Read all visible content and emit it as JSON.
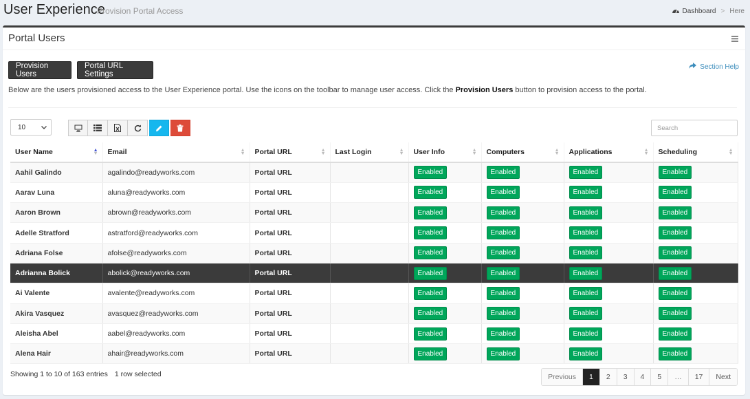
{
  "header": {
    "title": "User Experience",
    "subtitle": "Provision Portal Access",
    "breadcrumb": {
      "home": "Dashboard",
      "separator": ">",
      "current": "Here"
    }
  },
  "box": {
    "title": "Portal Users"
  },
  "buttons": {
    "provision_users": "Provision Users",
    "portal_url_settings": "Portal URL Settings",
    "section_help": "Section Help"
  },
  "description": {
    "part1": "Below are the users provisioned access to the User Experience portal. Use the icons on the toolbar to manage user access. Click the ",
    "bold": "Provision Users",
    "part2": " button to provision access to the portal."
  },
  "length_select": {
    "value": "10"
  },
  "search": {
    "placeholder": "Search"
  },
  "columns": [
    "User Name",
    "Email",
    "Portal URL",
    "Last Login",
    "User Info",
    "Computers",
    "Applications",
    "Scheduling"
  ],
  "rows": [
    {
      "name": "Aahil Galindo",
      "email": "agalindo@readyworks.com",
      "portal_url": "Portal URL",
      "last_login": "",
      "user_info": "Enabled",
      "computers": "Enabled",
      "applications": "Enabled",
      "scheduling": "Enabled"
    },
    {
      "name": "Aarav Luna",
      "email": "aluna@readyworks.com",
      "portal_url": "Portal URL",
      "last_login": "",
      "user_info": "Enabled",
      "computers": "Enabled",
      "applications": "Enabled",
      "scheduling": "Enabled"
    },
    {
      "name": "Aaron Brown",
      "email": "abrown@readyworks.com",
      "portal_url": "Portal URL",
      "last_login": "",
      "user_info": "Enabled",
      "computers": "Enabled",
      "applications": "Enabled",
      "scheduling": "Enabled"
    },
    {
      "name": "Adelle Stratford",
      "email": "astratford@readyworks.com",
      "portal_url": "Portal URL",
      "last_login": "",
      "user_info": "Enabled",
      "computers": "Enabled",
      "applications": "Enabled",
      "scheduling": "Enabled"
    },
    {
      "name": "Adriana Folse",
      "email": "afolse@readyworks.com",
      "portal_url": "Portal URL",
      "last_login": "",
      "user_info": "Enabled",
      "computers": "Enabled",
      "applications": "Enabled",
      "scheduling": "Enabled"
    },
    {
      "name": "Adrianna Bolick",
      "email": "abolick@readyworks.com",
      "portal_url": "Portal URL",
      "last_login": "",
      "user_info": "Enabled",
      "computers": "Enabled",
      "applications": "Enabled",
      "scheduling": "Enabled"
    },
    {
      "name": "Ai Valente",
      "email": "avalente@readyworks.com",
      "portal_url": "Portal URL",
      "last_login": "",
      "user_info": "Enabled",
      "computers": "Enabled",
      "applications": "Enabled",
      "scheduling": "Enabled"
    },
    {
      "name": "Akira Vasquez",
      "email": "avasquez@readyworks.com",
      "portal_url": "Portal URL",
      "last_login": "",
      "user_info": "Enabled",
      "computers": "Enabled",
      "applications": "Enabled",
      "scheduling": "Enabled"
    },
    {
      "name": "Aleisha Abel",
      "email": "aabel@readyworks.com",
      "portal_url": "Portal URL",
      "last_login": "",
      "user_info": "Enabled",
      "computers": "Enabled",
      "applications": "Enabled",
      "scheduling": "Enabled"
    },
    {
      "name": "Alena Hair",
      "email": "ahair@readyworks.com",
      "portal_url": "Portal URL",
      "last_login": "",
      "user_info": "Enabled",
      "computers": "Enabled",
      "applications": "Enabled",
      "scheduling": "Enabled"
    }
  ],
  "selected_row_index": 5,
  "footer": {
    "info": "Showing 1 to 10 of 163 entries",
    "selected": "1 row selected"
  },
  "pagination": {
    "previous": "Previous",
    "pages": [
      "1",
      "2",
      "3",
      "4",
      "5",
      "…",
      "17"
    ],
    "active": "1",
    "next": "Next"
  },
  "icons": {
    "breadcrumb": "dashboard-icon",
    "menu": "hamburger-menu-icon",
    "help": "share-arrow-icon",
    "toolbar": [
      "monitor-icon",
      "list-icon",
      "excel-export-icon",
      "refresh-icon",
      "pencil-edit-icon",
      "trash-delete-icon"
    ]
  },
  "colors": {
    "accent_dark": "#3b3b3b",
    "badge_green": "#00a65a",
    "edit_blue": "#16b7ee",
    "delete_red": "#dd4b39",
    "link_blue": "#3c8dbc"
  }
}
